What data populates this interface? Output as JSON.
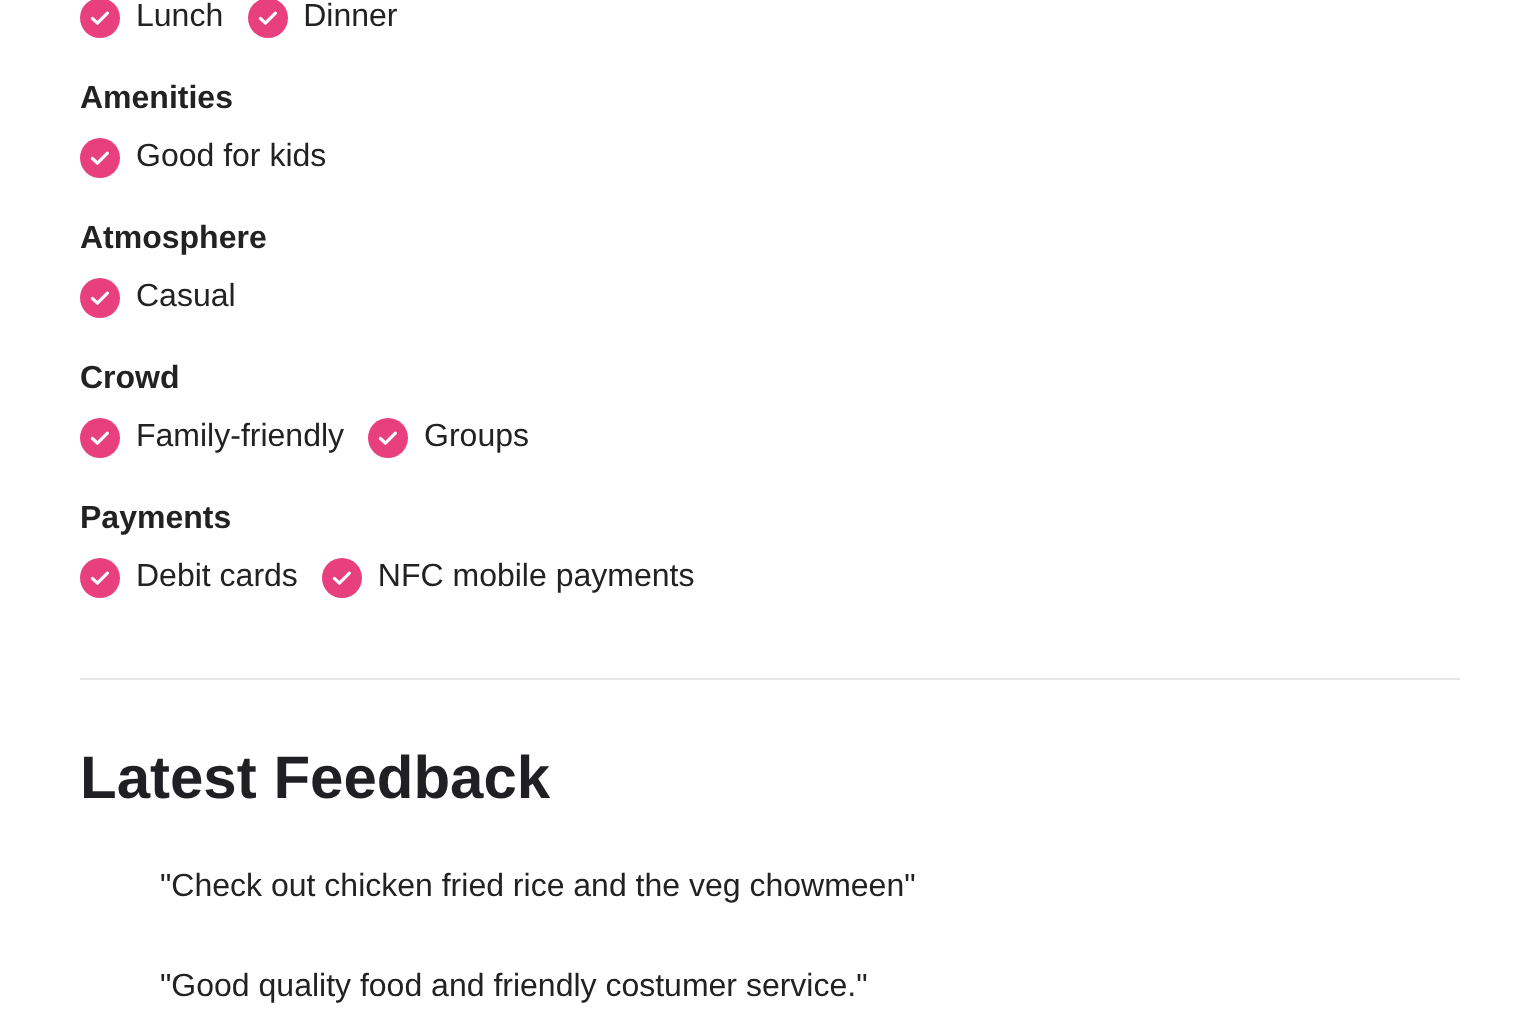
{
  "feature_groups": [
    {
      "items": [
        "Lunch",
        "Dinner"
      ]
    },
    {
      "heading": "Amenities",
      "items": [
        "Good for kids"
      ]
    },
    {
      "heading": "Atmosphere",
      "items": [
        "Casual"
      ]
    },
    {
      "heading": "Crowd",
      "items": [
        "Family-friendly",
        "Groups"
      ]
    },
    {
      "heading": "Payments",
      "items": [
        "Debit cards",
        "NFC mobile payments"
      ]
    }
  ],
  "feedback": {
    "heading": "Latest Feedback",
    "quotes": [
      "\"Check out chicken fried rice and the veg chowmeen\"",
      "\"Good quality food and friendly costumer service.\""
    ]
  }
}
